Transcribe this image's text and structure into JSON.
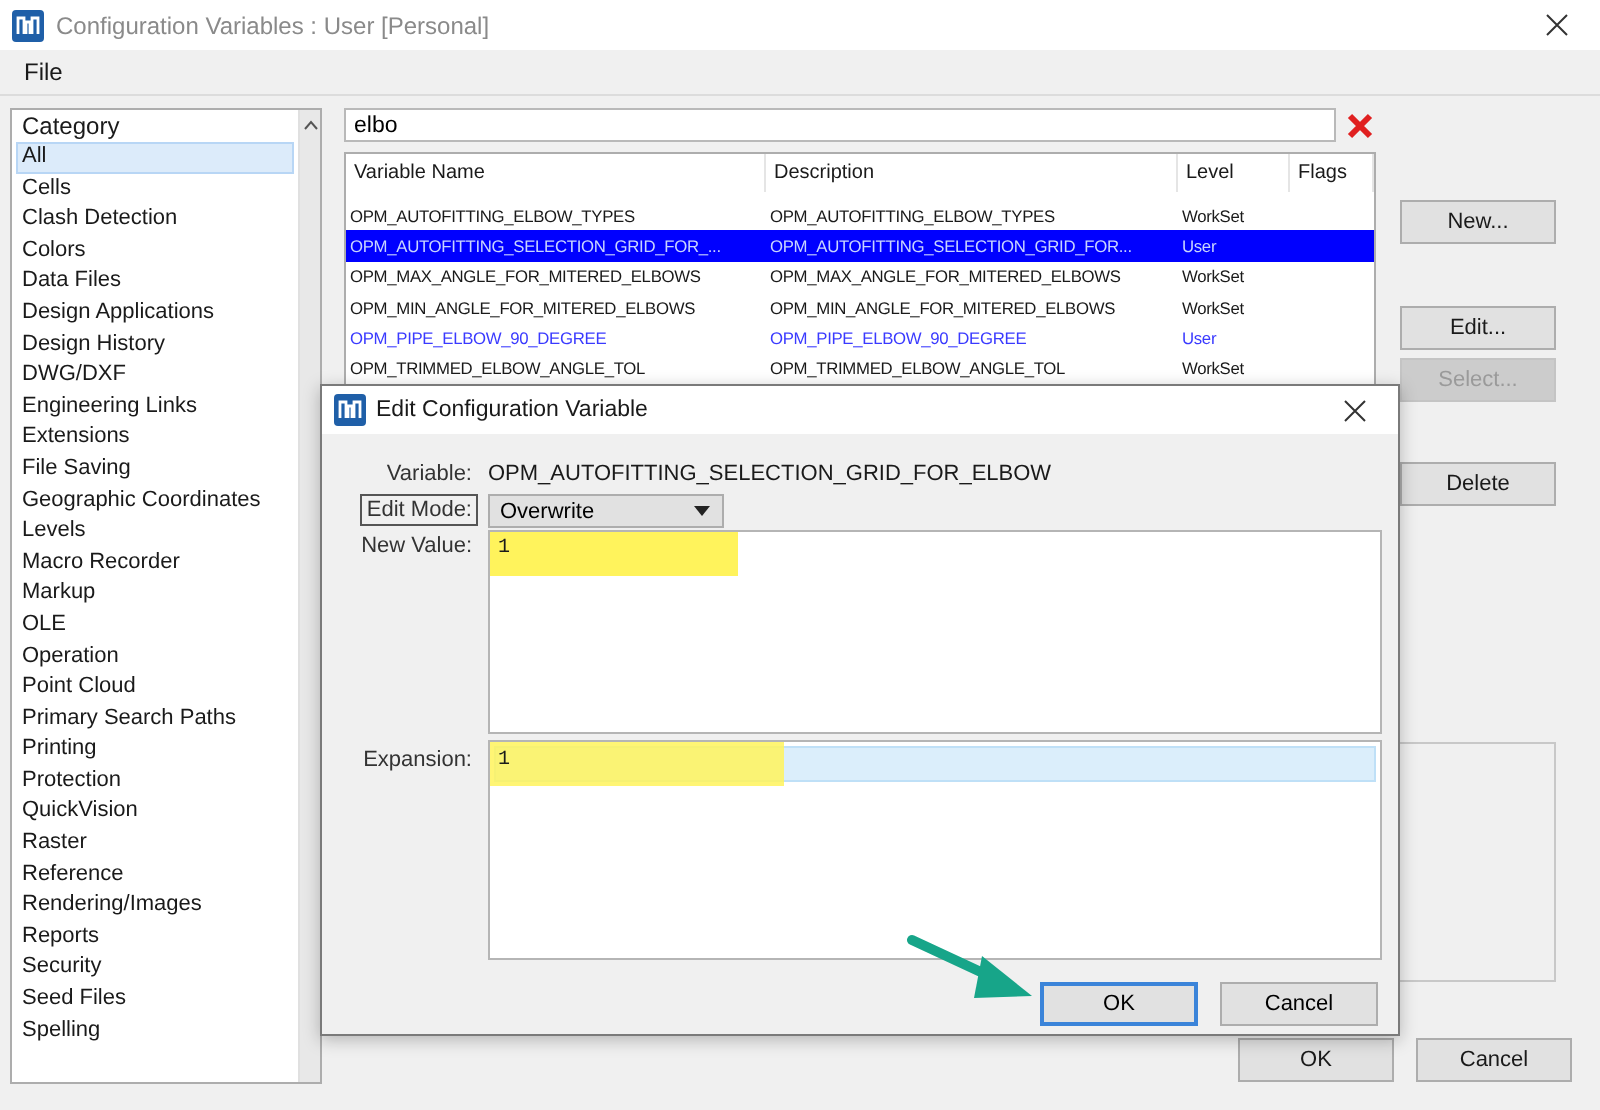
{
  "window": {
    "title": "Configuration Variables : User [Personal]"
  },
  "menu": [
    {
      "label": "File"
    }
  ],
  "category": {
    "header": "Category",
    "items": [
      {
        "label": "All",
        "selected": true
      },
      {
        "label": "Cells",
        "selected": false
      },
      {
        "label": "Clash Detection",
        "selected": false
      },
      {
        "label": "Colors",
        "selected": false
      },
      {
        "label": "Data Files",
        "selected": false
      },
      {
        "label": "Design Applications",
        "selected": false
      },
      {
        "label": "Design History",
        "selected": false
      },
      {
        "label": "DWG/DXF",
        "selected": false
      },
      {
        "label": "Engineering Links",
        "selected": false
      },
      {
        "label": "Extensions",
        "selected": false
      },
      {
        "label": "File Saving",
        "selected": false
      },
      {
        "label": "Geographic Coordinates",
        "selected": false
      },
      {
        "label": "Levels",
        "selected": false
      },
      {
        "label": "Macro Recorder",
        "selected": false
      },
      {
        "label": "Markup",
        "selected": false
      },
      {
        "label": "OLE",
        "selected": false
      },
      {
        "label": "Operation",
        "selected": false
      },
      {
        "label": "Point Cloud",
        "selected": false
      },
      {
        "label": "Primary Search Paths",
        "selected": false
      },
      {
        "label": "Printing",
        "selected": false
      },
      {
        "label": "Protection",
        "selected": false
      },
      {
        "label": "QuickVision",
        "selected": false
      },
      {
        "label": "Raster",
        "selected": false
      },
      {
        "label": "Reference",
        "selected": false
      },
      {
        "label": "Rendering/Images",
        "selected": false
      },
      {
        "label": "Reports",
        "selected": false
      },
      {
        "label": "Security",
        "selected": false
      },
      {
        "label": "Seed Files",
        "selected": false
      },
      {
        "label": "Spelling",
        "selected": false
      }
    ]
  },
  "search": {
    "value": "elbo"
  },
  "table": {
    "columns": [
      "Variable Name",
      "Description",
      "Level",
      "Flags"
    ],
    "rows": [
      {
        "cells": [
          "OPM_AUTOFITTING_ELBOW_TYPES",
          "OPM_AUTOFITTING_ELBOW_TYPES",
          "WorkSet"
        ],
        "selected": false,
        "modified": false
      },
      {
        "cells": [
          "OPM_AUTOFITTING_SELECTION_GRID_FOR_...",
          "OPM_AUTOFITTING_SELECTION_GRID_FOR...",
          "User"
        ],
        "selected": true,
        "modified": true
      },
      {
        "cells": [
          "OPM_MAX_ANGLE_FOR_MITERED_ELBOWS",
          "OPM_MAX_ANGLE_FOR_MITERED_ELBOWS",
          "WorkSet"
        ],
        "selected": false,
        "modified": false
      },
      {
        "cells": [
          "OPM_MIN_ANGLE_FOR_MITERED_ELBOWS",
          "OPM_MIN_ANGLE_FOR_MITERED_ELBOWS",
          "WorkSet"
        ],
        "selected": false,
        "modified": false
      },
      {
        "cells": [
          "OPM_PIPE_ELBOW_90_DEGREE",
          "OPM_PIPE_ELBOW_90_DEGREE",
          "User"
        ],
        "selected": false,
        "modified": true
      },
      {
        "cells": [
          "OPM_TRIMMED_ELBOW_ANGLE_TOL",
          "OPM_TRIMMED_ELBOW_ANGLE_TOL",
          "WorkSet"
        ],
        "selected": false,
        "modified": false
      }
    ]
  },
  "side_buttons": [
    {
      "label": "New...",
      "disabled": false
    },
    {
      "label": "Edit...",
      "disabled": false
    },
    {
      "label": "Select...",
      "disabled": true
    },
    {
      "label": "Delete",
      "disabled": false
    }
  ],
  "footer_buttons": [
    {
      "label": "OK"
    },
    {
      "label": "Cancel"
    }
  ],
  "dialog": {
    "title": "Edit Configuration Variable",
    "variable_label": "Variable:",
    "variable": "OPM_AUTOFITTING_SELECTION_GRID_FOR_ELBOW",
    "edit_mode_label": "Edit Mode:",
    "edit_mode": "Overwrite",
    "new_value_label": "New Value:",
    "new_value": "1",
    "expansion_label": "Expansion:",
    "expansion": "1",
    "buttons": [
      {
        "label": "OK",
        "focused": true
      },
      {
        "label": "Cancel",
        "focused": false
      }
    ]
  }
}
